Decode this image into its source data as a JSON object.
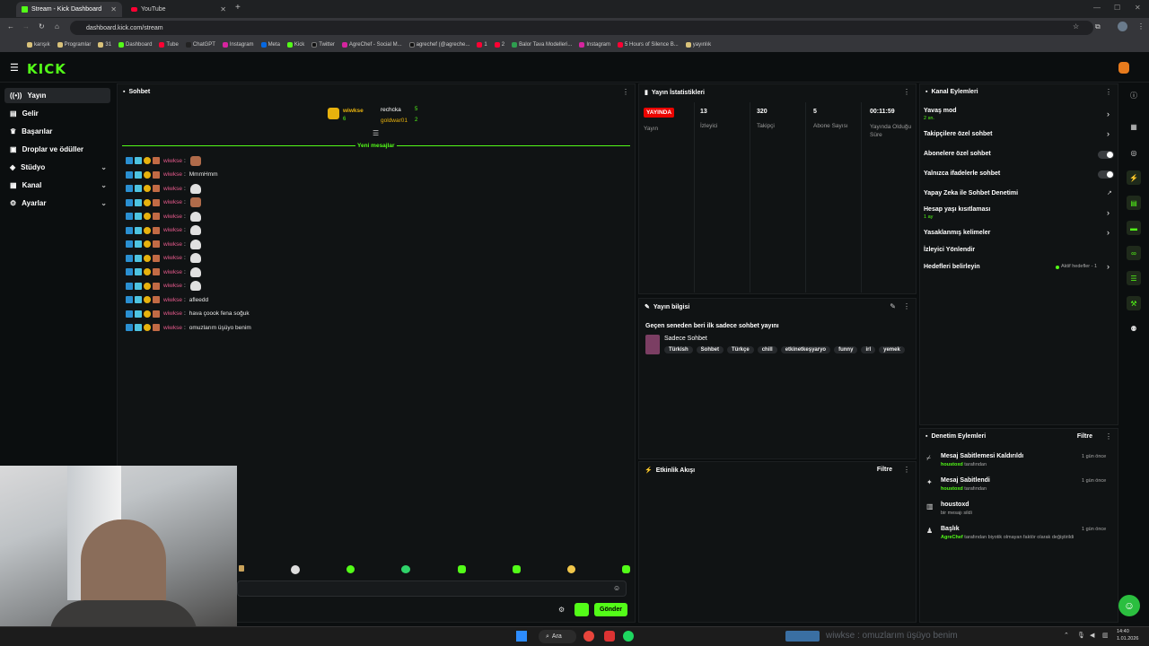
{
  "browser": {
    "tabs": [
      {
        "label": "Stream - Kick Dashboard",
        "active": true
      },
      {
        "label": "YouTube",
        "active": false
      }
    ],
    "url": "dashboard.kick.com/stream",
    "bookmarks": [
      "karışık",
      "Programlar",
      "31",
      "Dashboard",
      "Tube",
      "ChatGPT",
      "Instagram",
      "Meta",
      "Kick",
      "Twitter",
      "AgreChef - Social M...",
      "agrechef (@agreche...",
      "1",
      "2",
      "Balor Tava Modelleri...",
      "Instagram",
      "5 Hours of Silence B...",
      "yayınlık"
    ]
  },
  "header": {
    "logo": "KICK"
  },
  "sidebar": {
    "items": [
      {
        "label": "Yayın",
        "active": true,
        "expandable": false
      },
      {
        "label": "Gelir",
        "active": false,
        "expandable": false
      },
      {
        "label": "Başarılar",
        "active": false,
        "expandable": false
      },
      {
        "label": "Droplar ve ödüller",
        "active": false,
        "expandable": false
      },
      {
        "label": "Stüdyo",
        "active": false,
        "expandable": true
      },
      {
        "label": "Kanal",
        "active": false,
        "expandable": true
      },
      {
        "label": "Ayarlar",
        "active": false,
        "expandable": true
      }
    ]
  },
  "chat": {
    "title": "Sohbet",
    "leaderboard": [
      {
        "name": "wiwkse",
        "count": "6"
      },
      {
        "name": "rechcka",
        "count": "5"
      },
      {
        "name": "goldwar01",
        "count": "2"
      }
    ],
    "new_messages": "Yeni mesajlar",
    "messages": [
      {
        "user": "wiwkse",
        "text": "",
        "emote": "face"
      },
      {
        "user": "wiwkse",
        "text": "MmmHmm",
        "emote": ""
      },
      {
        "user": "wiwkse",
        "text": "",
        "emote": "ghost"
      },
      {
        "user": "wiwkse",
        "text": "",
        "emote": "face"
      },
      {
        "user": "wiwkse",
        "text": "",
        "emote": "ghost"
      },
      {
        "user": "wiwkse",
        "text": "",
        "emote": "ghost"
      },
      {
        "user": "wiwkse",
        "text": "",
        "emote": "ghost"
      },
      {
        "user": "wiwkse",
        "text": "",
        "emote": "ghost"
      },
      {
        "user": "wiwkse",
        "text": "",
        "emote": "ghost"
      },
      {
        "user": "wiwkse",
        "text": "",
        "emote": "ghost"
      },
      {
        "user": "wiwkse",
        "text": "afleedd",
        "emote": ""
      },
      {
        "user": "wiwkse",
        "text": "hava çoook fena soğuk",
        "emote": ""
      },
      {
        "user": "wiwkse",
        "text": "omuzlarım üşüyo benim",
        "emote": ""
      }
    ],
    "send_label": "Gönder"
  },
  "stats": {
    "title": "Yayın İstatistikleri",
    "live_badge": "YAYINDA",
    "live_label": "Yayın",
    "items": [
      {
        "value": "13",
        "label": "İzleyici"
      },
      {
        "value": "320",
        "label": "Takipçi"
      },
      {
        "value": "5",
        "label": "Abone Sayısı"
      },
      {
        "value": "00:11:59",
        "label": "Yayında Olduğu Süre"
      }
    ]
  },
  "stream_info": {
    "title": "Yayın bilgisi",
    "stream_title": "Geçen seneden beri ilk sadece sohbet yayını",
    "category": "Sadece Sohbet",
    "tags": [
      "Türkish",
      "Sohbet",
      "Türkçe",
      "chill",
      "etkinetkeşyaryo",
      "funny",
      "irl",
      "yemek"
    ]
  },
  "activity": {
    "title": "Etkinlik Akışı",
    "filter": "Filtre"
  },
  "channel_actions": {
    "title": "Kanal Eylemleri",
    "items": [
      {
        "label": "Yavaş mod",
        "sub": "2 sn.",
        "control": "arrow"
      },
      {
        "label": "Takipçilere özel sohbet",
        "sub": "",
        "control": "arrow"
      },
      {
        "label": "Abonelere özel sohbet",
        "sub": "",
        "control": "toggle"
      },
      {
        "label": "Yalnızca ifadelerle sohbet",
        "sub": "",
        "control": "toggle"
      },
      {
        "label": "Yapay Zeka ile Sohbet Denetimi",
        "sub": "",
        "control": "external"
      },
      {
        "label": "Hesap yaşı kısıtlaması",
        "sub": "1 ay",
        "control": "arrow"
      },
      {
        "label": "Yasaklanmış kelimeler",
        "sub": "",
        "control": "arrow"
      },
      {
        "label": "İzleyici Yönlendir",
        "sub": "",
        "control": "none"
      },
      {
        "label": "Hedefleri belirleyin",
        "sub": "",
        "control": "goals"
      }
    ],
    "goals_status": "Aktif hedefler - 1"
  },
  "moderation": {
    "title": "Denetim Eylemleri",
    "filter": "Filtre",
    "items": [
      {
        "title": "Mesaj Sabitlemesi Kaldırıldı",
        "actor": "houstoxd",
        "detail": "tarafından",
        "time": "1 gün önce"
      },
      {
        "title": "Mesaj Sabitlendi",
        "actor": "houstoxd",
        "detail": "tarafından",
        "time": "1 gün önce"
      },
      {
        "title": "houstoxd",
        "actor": "",
        "detail": "bir mesajı sildi",
        "time": "1 gün önce"
      },
      {
        "title": "Başlık",
        "actor": "AgreChef",
        "detail": "tarafından biyotik olmayan faktör olarak değiştirildi",
        "time": "1 gün önce"
      }
    ]
  },
  "taskbar": {
    "search": "Ara",
    "ticker": "wiwkse : omuzlarım üşüyo benim",
    "time": "14:40",
    "date": "1.01.2026"
  },
  "colors": {
    "accent": "#53fc18",
    "live": "#eb0400",
    "username": "#e65a8c",
    "bg": "#0b0e0f",
    "panel": "#101314"
  }
}
